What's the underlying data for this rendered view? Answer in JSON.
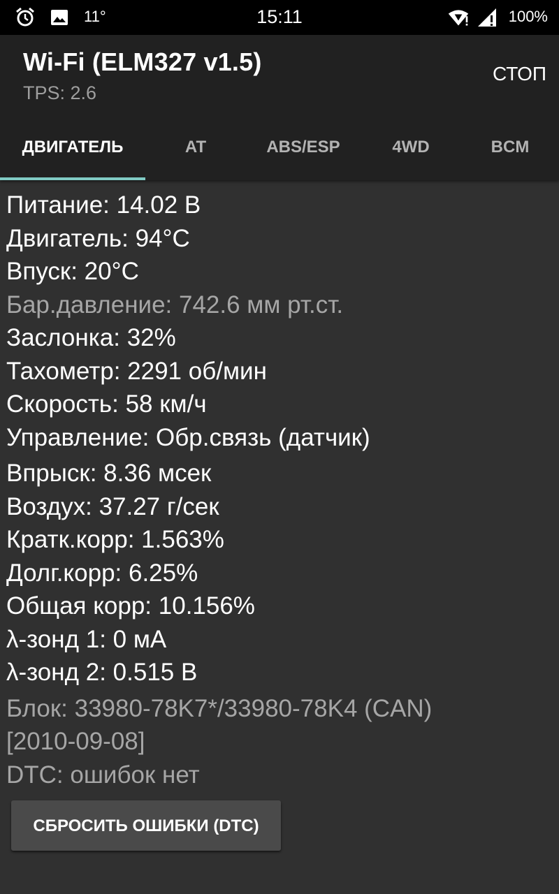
{
  "status_bar": {
    "temperature": "11°",
    "time": "15:11",
    "battery": "100%",
    "icons": [
      "alarm-icon",
      "image-icon",
      "wifi-icon",
      "signal-icon"
    ]
  },
  "app_bar": {
    "title": "Wi-Fi (ELM327 v1.5)",
    "subtitle": "TPS: 2.6",
    "stop_label": "СТОП"
  },
  "tabs": [
    {
      "label": "ДВИГАТЕЛЬ",
      "active": true
    },
    {
      "label": "AT",
      "active": false
    },
    {
      "label": "ABS/ESP",
      "active": false
    },
    {
      "label": "4WD",
      "active": false
    },
    {
      "label": "BCM",
      "active": false
    }
  ],
  "readings": {
    "power": "Питание: 14.02 В",
    "engine": "Двигатель: 94°C",
    "intake": "Впуск: 20°C",
    "baro": "Бар.давление: 742.6 мм рт.ст.",
    "throttle": "Заслонка: 32%",
    "tacho": "Тахометр: 2291 об/мин",
    "speed": "Скорость: 58 км/ч",
    "control": "Управление: Обр.связь (датчик)",
    "injection": "Впрыск: 8.36 мсек",
    "air": "Воздух: 37.27 г/сек",
    "short_trim": "Кратк.корр: 1.563%",
    "long_trim": "Долг.корр: 6.25%",
    "total_trim": "Общая корр: 10.156%",
    "lambda1": "λ-зонд 1: 0 мА",
    "lambda2": "λ-зонд 2: 0.515 В"
  },
  "ecu": {
    "block": "Блок: 33980-78K7*/33980-78K4 (CAN)",
    "date": "[2010-09-08]",
    "dtc": "DTC: ошибок нет"
  },
  "reset_button_label": "СБРОСИТЬ ОШИБКИ (DTC)",
  "colors": {
    "background": "#303030",
    "app_bar": "#212121",
    "tab_indicator": "#80cbc4",
    "dim_text": "#a6a6a6",
    "button": "#4a4a4a"
  }
}
